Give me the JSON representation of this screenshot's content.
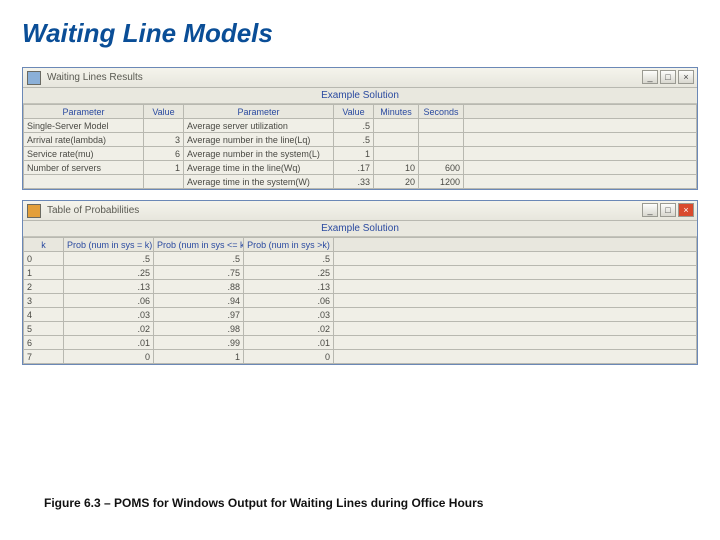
{
  "slide_title": "Waiting Line Models",
  "caption": "Figure 6.3 – POMS for Windows Output for Waiting Lines during Office Hours",
  "win1": {
    "title": "Waiting Lines Results",
    "subtitle": "Example Solution",
    "headers": [
      "Parameter",
      "Value",
      "Parameter",
      "Value",
      "Minutes",
      "Seconds"
    ],
    "rows": [
      [
        "Single-Server Model",
        "",
        "Average server utilization",
        ".5",
        "",
        ""
      ],
      [
        "Arrival rate(lambda)",
        "3",
        "Average number in the line(Lq)",
        ".5",
        "",
        ""
      ],
      [
        "Service rate(mu)",
        "6",
        "Average number in the system(L)",
        "1",
        "",
        ""
      ],
      [
        "Number of servers",
        "1",
        "Average time in the line(Wq)",
        ".17",
        "10",
        "600"
      ],
      [
        "",
        "",
        "Average time in the system(W)",
        ".33",
        "20",
        "1200"
      ]
    ]
  },
  "win2": {
    "title": "Table of Probabilities",
    "subtitle": "Example Solution",
    "headers": [
      "k",
      "Prob (num in sys = k)",
      "Prob (num in sys <= k)",
      "Prob (num in sys >k)"
    ],
    "rows": [
      [
        "0",
        ".5",
        ".5",
        ".5"
      ],
      [
        "1",
        ".25",
        ".75",
        ".25"
      ],
      [
        "2",
        ".13",
        ".88",
        ".13"
      ],
      [
        "3",
        ".06",
        ".94",
        ".06"
      ],
      [
        "4",
        ".03",
        ".97",
        ".03"
      ],
      [
        "5",
        ".02",
        ".98",
        ".02"
      ],
      [
        "6",
        ".01",
        ".99",
        ".01"
      ],
      [
        "7",
        "0",
        "1",
        "0"
      ]
    ]
  }
}
